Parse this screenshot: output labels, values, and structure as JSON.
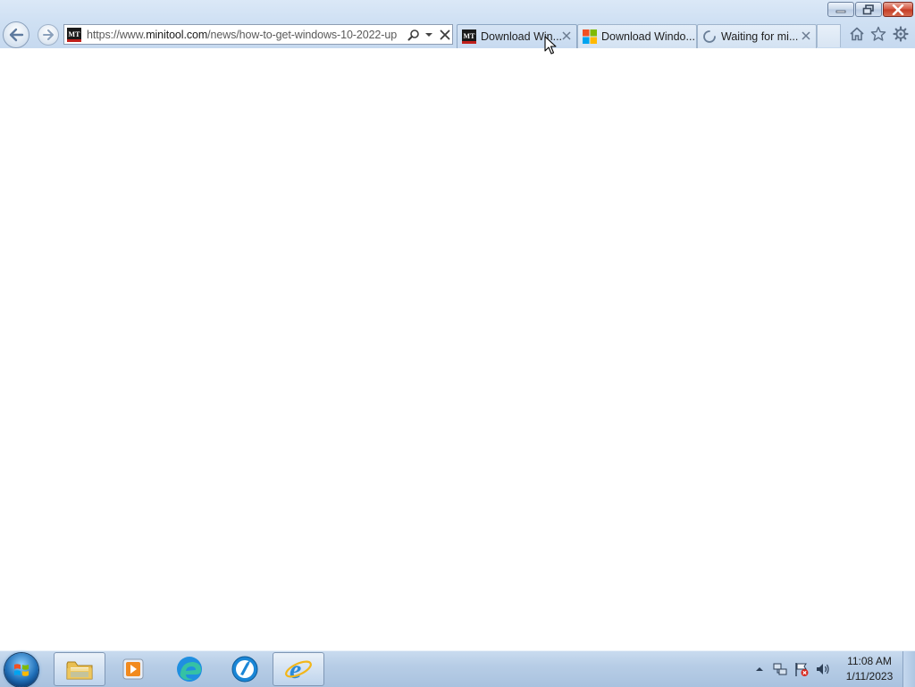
{
  "window": {
    "minimize_label": "Minimize",
    "restore_label": "Restore Down",
    "close_label": "Close"
  },
  "address_bar": {
    "favicon": "MT",
    "url_prefix": "https://www.",
    "url_domain": "minitool.com",
    "url_rest": "/news/how-to-get-windows-10-2022-up"
  },
  "tabs": [
    {
      "title": "Download Win...",
      "favicon": "minitool-favicon",
      "active": true
    },
    {
      "title": "Download Windo...",
      "favicon": "microsoft-favicon",
      "active": false
    },
    {
      "title": "Waiting for mi...",
      "favicon": "loading-spinner-icon",
      "active": false
    }
  ],
  "toolbar_icons": [
    "home-icon",
    "favorites-star-icon",
    "tools-gear-icon"
  ],
  "taskbar": {
    "pinned": [
      "windows-explorer-icon",
      "media-player-icon",
      "edge-icon",
      "browser-icon",
      "internet-explorer-icon"
    ],
    "active_app": "internet-explorer-icon"
  },
  "tray": {
    "icons": [
      "show-hidden-icons-arrow",
      "network-icon",
      "action-center-flag-icon",
      "volume-icon"
    ]
  },
  "clock": {
    "time": "11:08 AM",
    "date": "1/11/2023"
  }
}
